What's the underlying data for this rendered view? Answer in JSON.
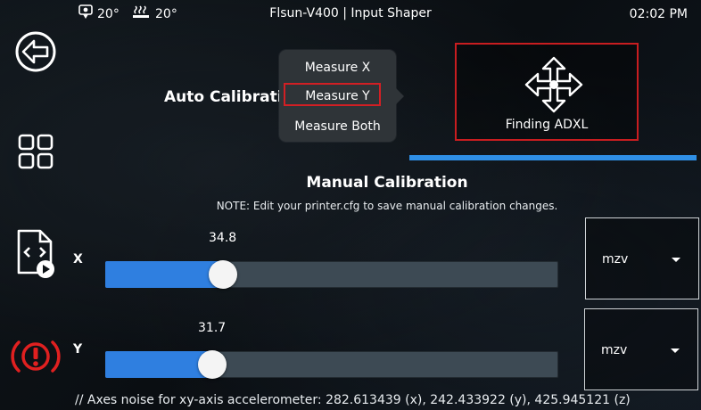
{
  "statusbar": {
    "extruder_temp": "20°",
    "bed_temp": "20°",
    "title": "Flsun-V400 | Input Shaper",
    "clock": "02:02 PM"
  },
  "sidebar": {
    "items": [
      {
        "icon": "back-arrow-icon"
      },
      {
        "icon": "grid-menu-icon"
      },
      {
        "icon": "macro-file-icon"
      },
      {
        "icon": "emergency-stop-icon"
      }
    ]
  },
  "auto_calibration": {
    "title": "Auto Calibration",
    "menu": {
      "items": [
        "Measure X",
        "Measure Y",
        "Measure Both"
      ],
      "highlighted": "Measure Y"
    },
    "finding_adxl_label": "Finding ADXL",
    "progress": 1.0
  },
  "manual_calibration": {
    "title": "Manual Calibration",
    "note": "NOTE: Edit your printer.cfg to save manual calibration changes.",
    "x": {
      "label": "X",
      "value": "34.8",
      "fill": 0.26,
      "shaper": "mzv"
    },
    "y": {
      "label": "Y",
      "value": "31.7",
      "fill": 0.237,
      "shaper": "mzv"
    }
  },
  "noise_text": "// Axes noise for xy-axis accelerometer: 282.613439 (x), 242.433922 (y), 425.945121 (z)",
  "colors": {
    "accent_blue": "#2f7fe0",
    "highlight_red": "#d21f24",
    "emergency_red": "#e02020"
  }
}
